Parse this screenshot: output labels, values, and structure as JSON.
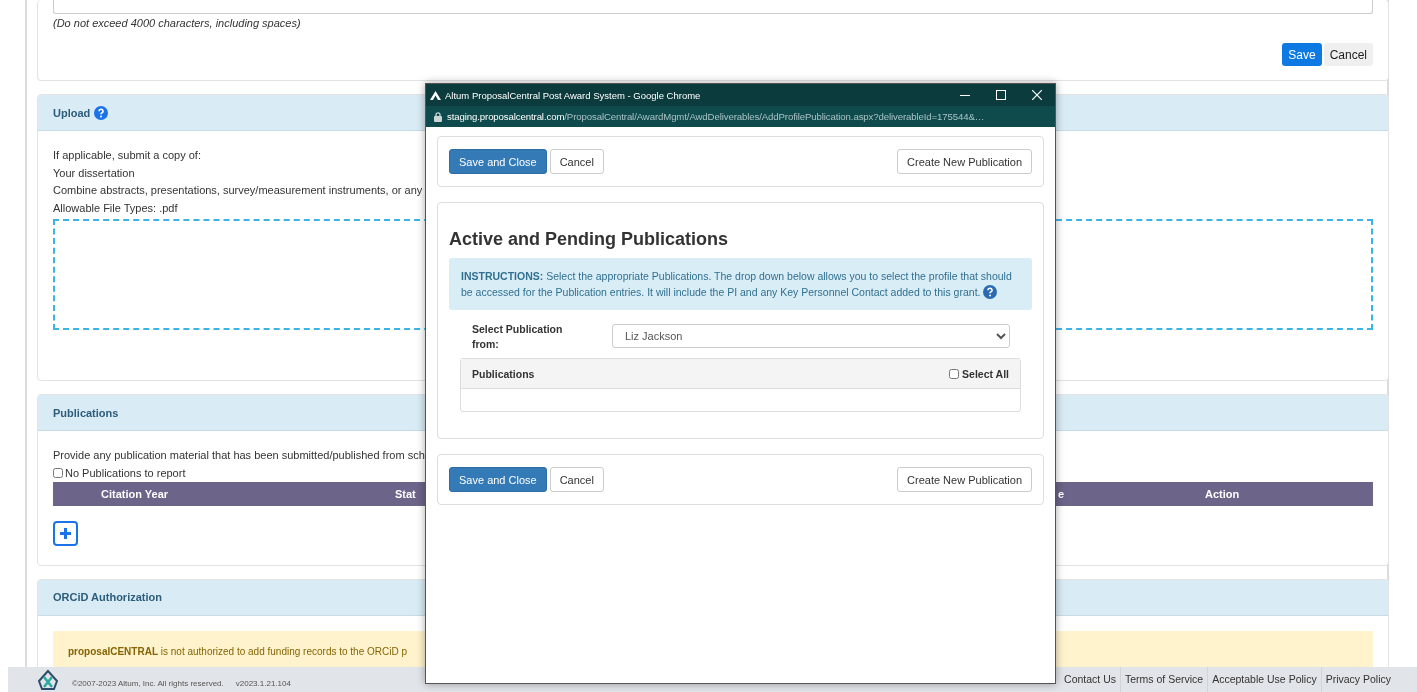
{
  "page": {
    "note": "(Do not exceed 4000 characters, including spaces)",
    "note_buttons": [
      {
        "label": "Save",
        "kind": "primary"
      },
      {
        "label": "Cancel",
        "kind": "secondary"
      }
    ],
    "upload": {
      "title": "Upload",
      "lines": [
        "If applicable, submit a copy of:",
        "Your dissertation",
        "Combine abstracts, presentations, survey/measurement instruments, or any",
        "Allowable File Types: .pdf"
      ]
    },
    "publications": {
      "title": "Publications",
      "text": "Provide any publication material that has been submitted/published from sch",
      "no_publications": {
        "label": "No Publications to report",
        "checked": false
      },
      "columns": [
        "Citation Year",
        "Stat",
        "e",
        "Action"
      ]
    },
    "orcid": {
      "title": "ORCiD Authorization",
      "message": "**proposalCENTRAL** is not authorized to add funding records to the ORCiD p"
    },
    "footer": {
      "copyright": "©2007-2023 Altum, Inc. All rights reserved.",
      "version": "v2023.1.21.104",
      "links": [
        "Contact Us",
        "Terms of Service",
        "Acceptable Use Policy",
        "Privacy Policy"
      ]
    }
  },
  "popup": {
    "title": "Altum ProposalCentral Post Award System - Google Chrome",
    "url_host": "staging.proposalcentral.com",
    "url_path": "/ProposalCentral/AwardMgmt/AwdDeliverables/AddProfilePublication.aspx?deliverableId=175544&…",
    "toolbar_top": [
      {
        "label": "Save and Close",
        "kind": "primary"
      },
      {
        "label": "Cancel",
        "kind": "default"
      },
      {
        "label": "Create New Publication",
        "kind": "right"
      }
    ],
    "heading": "Active and Pending Publications",
    "instructions": "**INSTRUCTIONS:** Select the appropriate Publications. The drop down below allows you to select the profile that should be accessed for the Publication entries. It will include the PI and any Key Personnel Contact added to this grant.",
    "select_label": "Select Publication from:",
    "select_value": "Liz Jackson",
    "table_header": "Publications",
    "select_all": {
      "label": "Select All",
      "checked": false
    },
    "toolbar_bottom": [
      {
        "label": "Save and Close",
        "kind": "primary"
      },
      {
        "label": "Cancel",
        "kind": "default"
      },
      {
        "label": "Create New Publication",
        "kind": "right"
      }
    ]
  }
}
